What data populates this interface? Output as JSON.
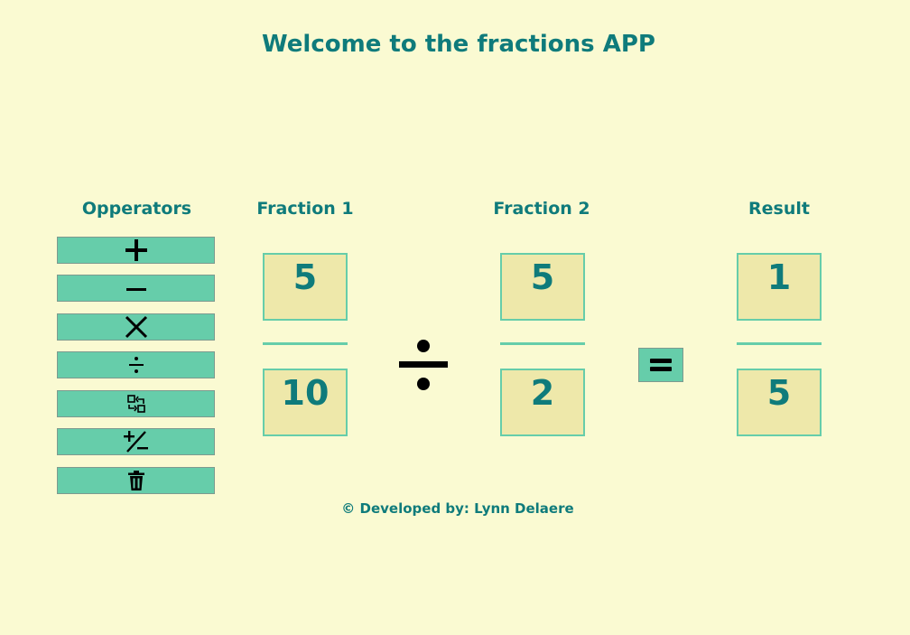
{
  "title": "Welcome to the fractions APP",
  "headers": {
    "operators": "Opperators",
    "fraction1": "Fraction 1",
    "fraction2": "Fraction 2",
    "result": "Result"
  },
  "operators": [
    {
      "name": "plus",
      "icon": "plus-icon"
    },
    {
      "name": "minus",
      "icon": "minus-icon"
    },
    {
      "name": "multiply",
      "icon": "multiply-icon"
    },
    {
      "name": "divide",
      "icon": "divide-icon"
    },
    {
      "name": "swap",
      "icon": "swap-icon"
    },
    {
      "name": "plus-minus",
      "icon": "plus-minus-icon"
    },
    {
      "name": "delete",
      "icon": "trash-icon"
    }
  ],
  "fraction1": {
    "numerator": "5",
    "denominator": "10"
  },
  "fraction2": {
    "numerator": "5",
    "denominator": "2"
  },
  "result": {
    "numerator": "1",
    "denominator": "5"
  },
  "selected_operator": {
    "name": "divide",
    "icon": "divide-icon"
  },
  "equals": {
    "icon": "equals-icon"
  },
  "footer": "© Developed by: Lynn Delaere",
  "colors": {
    "background": "#fafad2",
    "text": "#0f7b7b",
    "button": "#66cdaa",
    "box": "#eee8aa"
  }
}
